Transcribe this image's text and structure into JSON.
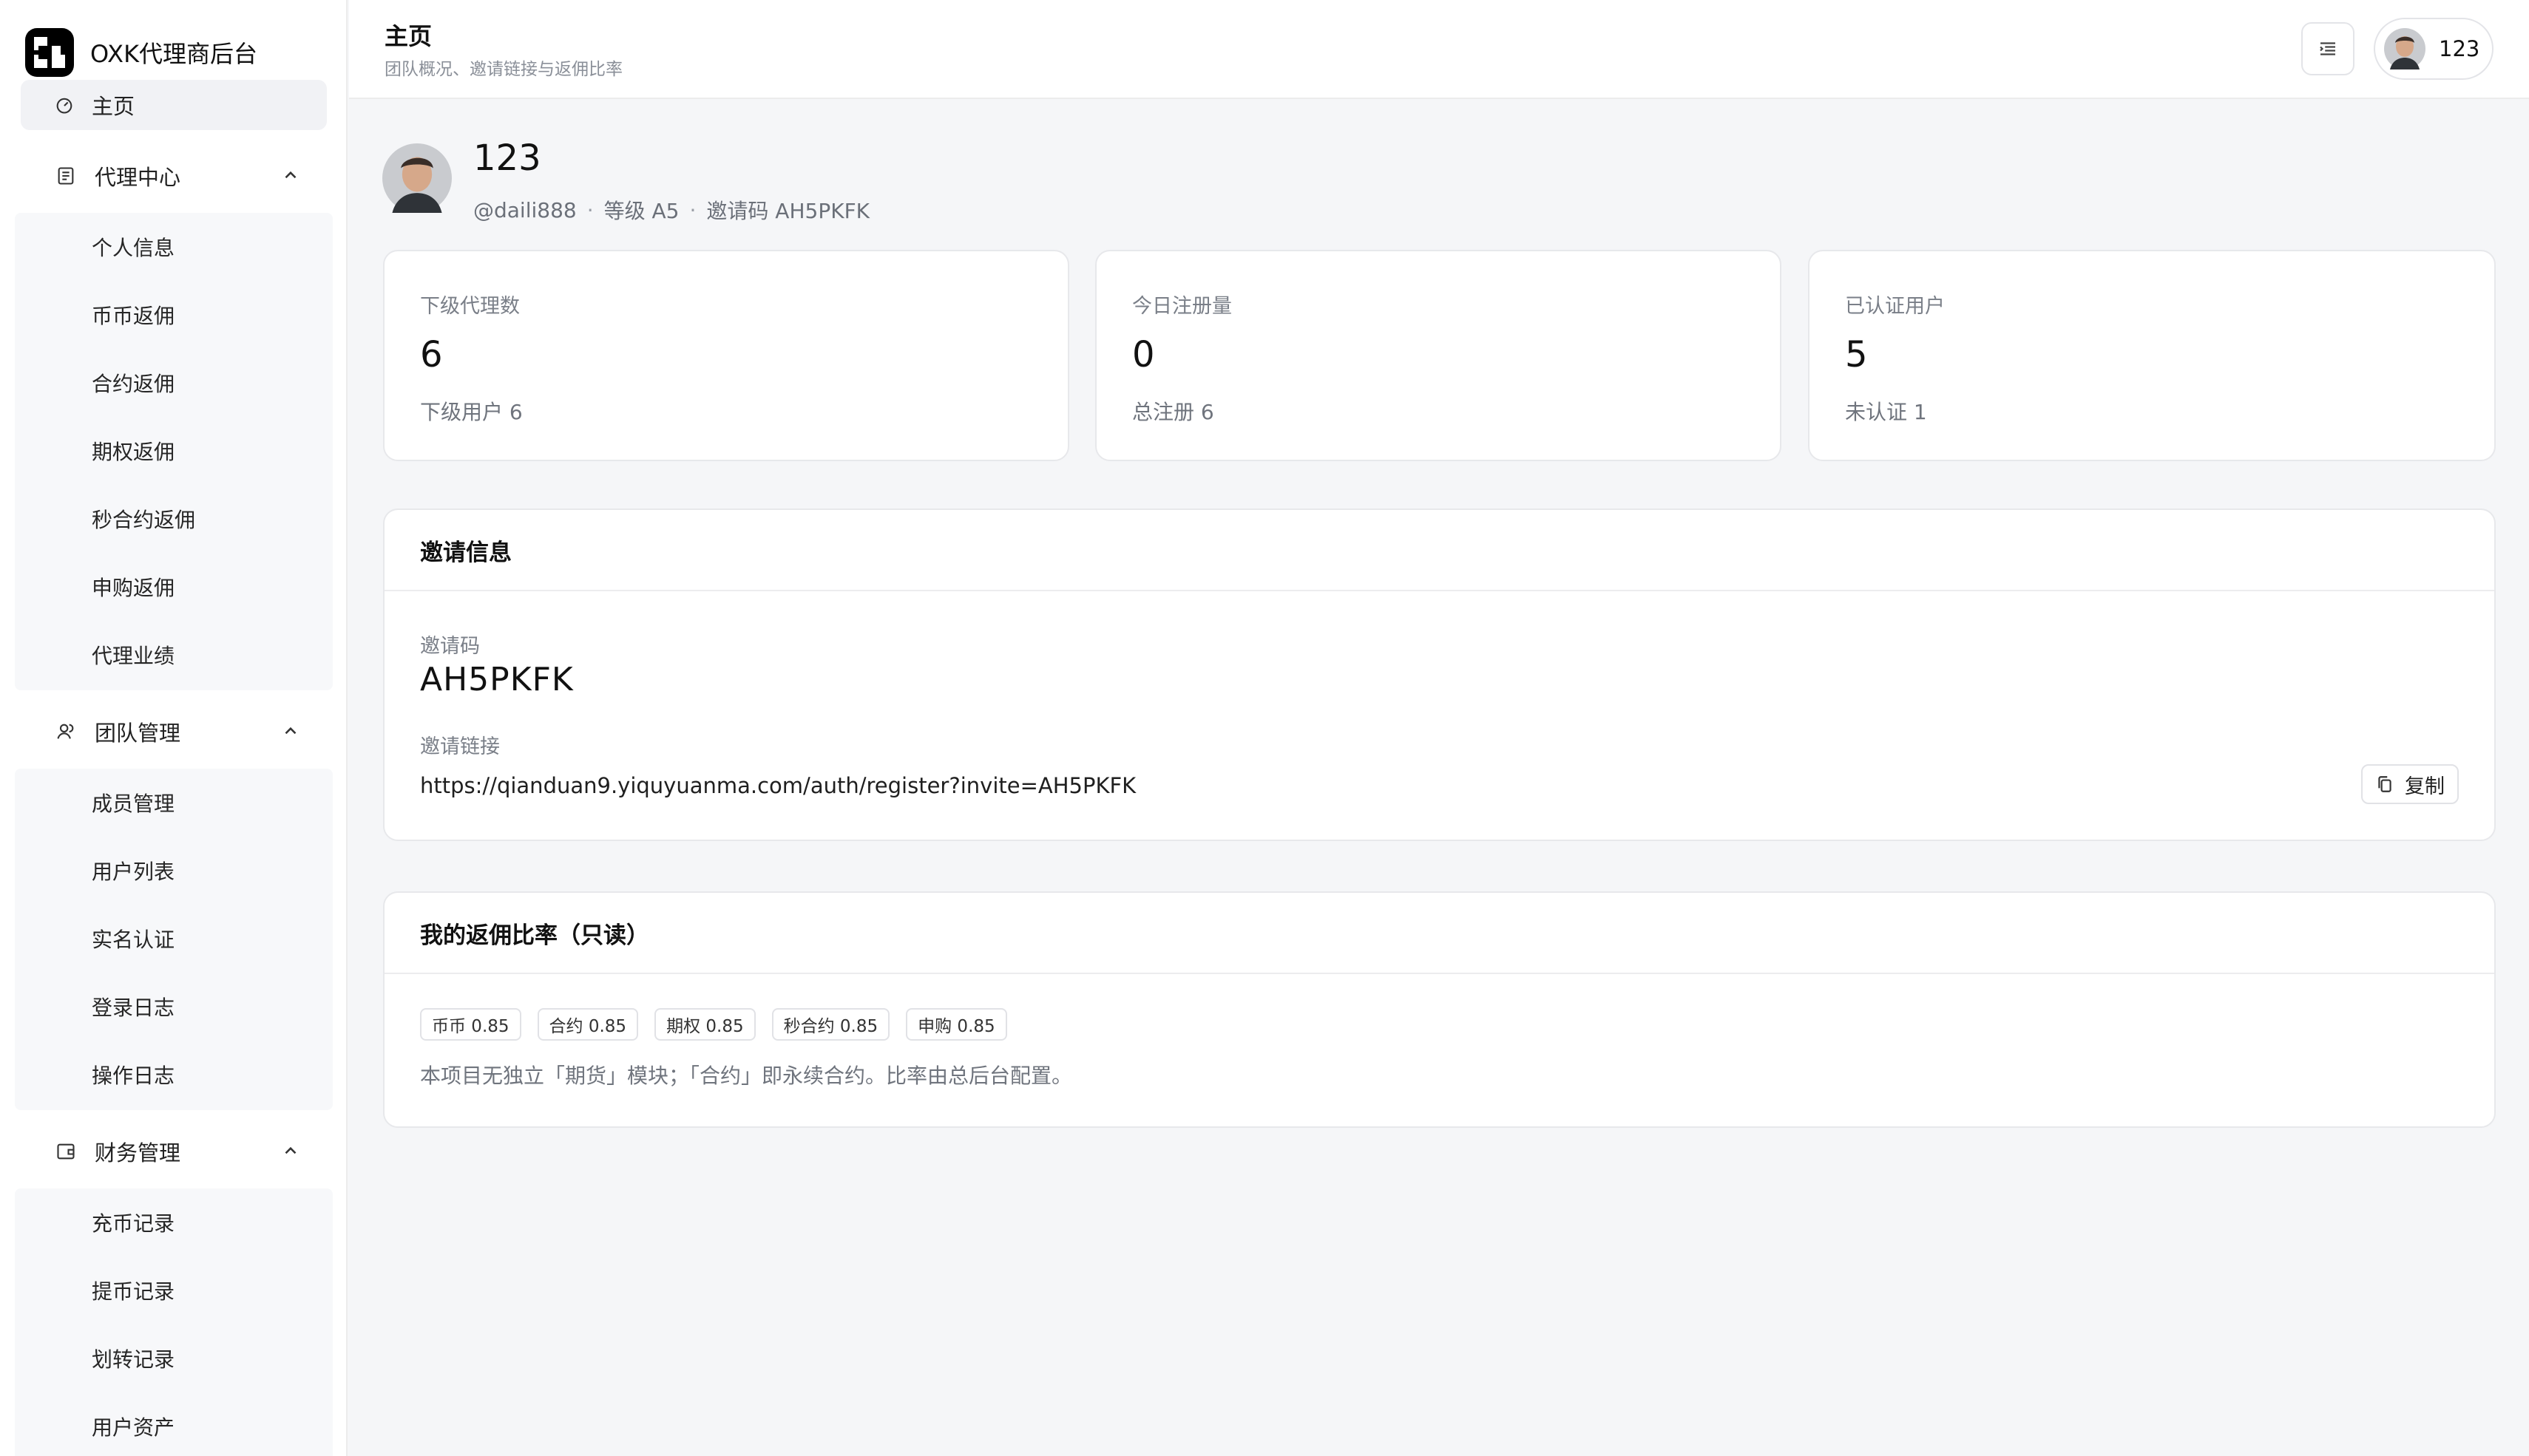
{
  "app": {
    "name": "OXK代理商后台"
  },
  "sidebar": {
    "home_label": "主页",
    "groups": [
      {
        "label": "代理中心",
        "items": [
          "个人信息",
          "币币返佣",
          "合约返佣",
          "期权返佣",
          "秒合约返佣",
          "申购返佣",
          "代理业绩"
        ]
      },
      {
        "label": "团队管理",
        "items": [
          "成员管理",
          "用户列表",
          "实名认证",
          "登录日志",
          "操作日志"
        ]
      },
      {
        "label": "财务管理",
        "items": [
          "充币记录",
          "提币记录",
          "划转记录",
          "用户资产"
        ]
      }
    ]
  },
  "header": {
    "title": "主页",
    "subtitle": "团队概况、邀请链接与返佣比率",
    "user_name": "123"
  },
  "profile": {
    "name": "123",
    "handle": "@daili888",
    "level": "等级 A5",
    "invite": "邀请码 AH5PKFK"
  },
  "stats": [
    {
      "label": "下级代理数",
      "value": "6",
      "foot": "下级用户 6"
    },
    {
      "label": "今日注册量",
      "value": "0",
      "foot": "总注册 6"
    },
    {
      "label": "已认证用户",
      "value": "5",
      "foot": "未认证 1"
    }
  ],
  "invite_card": {
    "title": "邀请信息",
    "code_label": "邀请码",
    "code": "AH5PKFK",
    "link_label": "邀请链接",
    "link": "https://qianduan9.yiquyuanma.com/auth/register?invite=AH5PKFK",
    "copy_label": "复制"
  },
  "rates_card": {
    "title": "我的返佣比率（只读）",
    "tags": [
      "币币 0.85",
      "合约 0.85",
      "期权 0.85",
      "秒合约 0.85",
      "申购 0.85"
    ],
    "note": "本项目无独立「期货」模块；「合约」即永续合约。比率由总后台配置。"
  },
  "icons": {
    "home": "dashboard-icon",
    "agent": "document-icon",
    "team": "users-icon",
    "finance": "wallet-icon",
    "menu": "menu-icon",
    "copy": "copy-icon"
  }
}
